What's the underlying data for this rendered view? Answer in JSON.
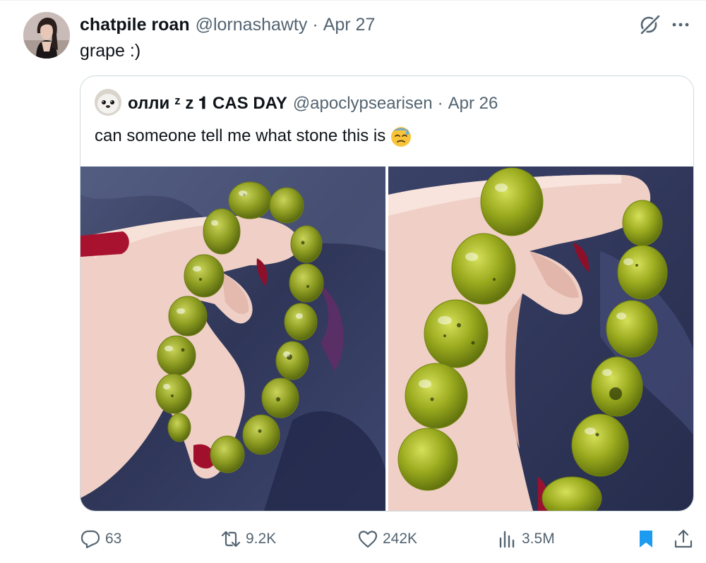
{
  "post": {
    "author_name": "chatpile roan",
    "author_handle": "@lornashawty",
    "separator": "·",
    "date": "Apr 27",
    "text": "grape :)"
  },
  "quoted_post": {
    "author_name": "олли ᶻ z 𝟏 CAS DAY",
    "author_handle": "@apoclypsearisen",
    "separator": "·",
    "date": "Apr 26",
    "text": "can someone tell me what stone this is",
    "emoji": "downcast-face-with-sweat"
  },
  "actions": {
    "replies": "63",
    "reposts": "9.2K",
    "likes": "242K",
    "views": "3.5M"
  },
  "colors": {
    "text_primary": "#0f1419",
    "text_secondary": "#536471",
    "border": "#cfd9de",
    "bookmark_active": "#1d9bf0"
  },
  "icons": [
    "grok-icon",
    "more-icon",
    "reply-icon",
    "repost-icon",
    "like-icon",
    "views-icon",
    "bookmark-icon",
    "share-icon"
  ]
}
